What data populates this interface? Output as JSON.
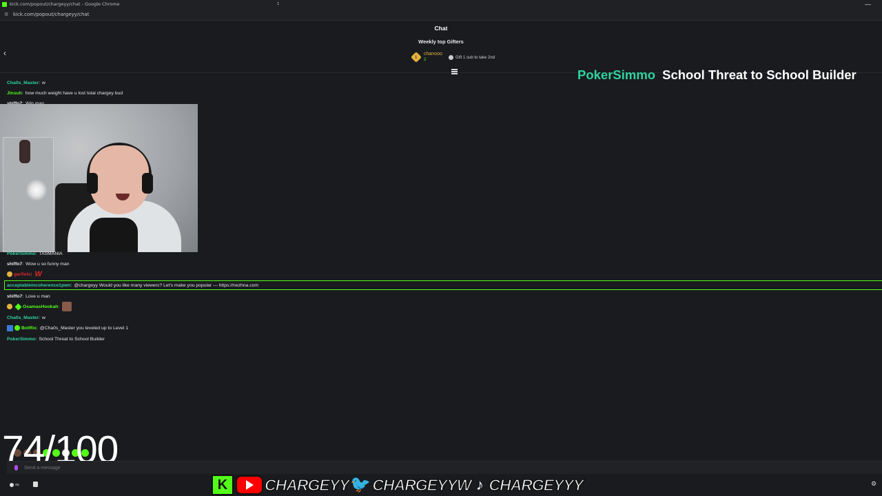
{
  "browser": {
    "title": "kick.com/popout/chargeyy/chat - Google Chrome",
    "url": "kick.com/popout/chargeyy/chat"
  },
  "chat": {
    "header": "Chat",
    "gifters_title": "Weekly top Gifters",
    "top_gifter": {
      "rank": "1",
      "name": "chanooo",
      "count": "2"
    },
    "gift_hint": "Gift 1 sub to take 2nd",
    "input_placeholder": "Send a message",
    "messages": [
      {
        "user": "Cha0s_Master",
        "color": "#2fd3a0",
        "text": "w"
      },
      {
        "user": "Jinsuh",
        "color": "#53fc18",
        "text": "how much weight have u lost total chargey bud"
      },
      {
        "user": "shiffo7",
        "color": "#e8e8e8",
        "text": "Win man"
      },
      {
        "user": "PokerSimmo",
        "color": "#2fd3a0",
        "text": "TASMANIA"
      },
      {
        "user": "shiffo7",
        "color": "#e8e8e8",
        "text": "Wow u so funny man"
      },
      {
        "user": "garfielo",
        "color": "#e0262b",
        "text": "W"
      },
      {
        "user": "acceptableincoherence1pwn",
        "color": "#2fd3a0",
        "text": "@chargeyy Would you like many viewers? Let's make you popular — https://nezhna.com"
      },
      {
        "user": "shiffo7",
        "color": "#e8e8e8",
        "text": "Love u man"
      },
      {
        "user": "OsamasHookah",
        "color": "#53fc18",
        "text": ""
      },
      {
        "user": "Cha0s_Master",
        "color": "#2fd3a0",
        "text": "w"
      },
      {
        "user": "BotRix",
        "color": "#53fc18",
        "text": "@Cha0s_Master you leveled up to Level 1"
      },
      {
        "user": "PokerSimmo",
        "color": "#2fd3a0",
        "text": "School Threat to School Builder"
      }
    ]
  },
  "overlay": {
    "banner_user": "PokerSimmo",
    "banner_text": "School Threat to School Builder",
    "goal": "74/100",
    "handles": [
      "CHARGEYY",
      "CHARGEYYW",
      "CHARGEYYY"
    ]
  },
  "bottom": {
    "people_count": "∞"
  },
  "colors": {
    "kick_green": "#53fc18",
    "teal_user": "#2fd3a0",
    "gold": "#e3b340",
    "background": "#191b1f"
  }
}
